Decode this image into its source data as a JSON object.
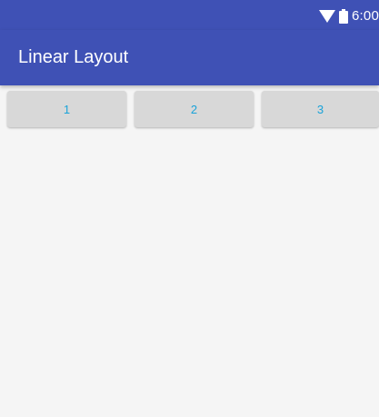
{
  "status_bar": {
    "time": "6:00",
    "icons": [
      "wifi-icon",
      "battery-icon"
    ]
  },
  "app_bar": {
    "title": "Linear Layout"
  },
  "buttons": [
    {
      "label": "1"
    },
    {
      "label": "2"
    },
    {
      "label": "3"
    }
  ],
  "colors": {
    "primary": "#3f51b5",
    "button_text": "#1aa3d9",
    "button_bg": "#d8d8d8",
    "background": "#f5f5f5"
  }
}
